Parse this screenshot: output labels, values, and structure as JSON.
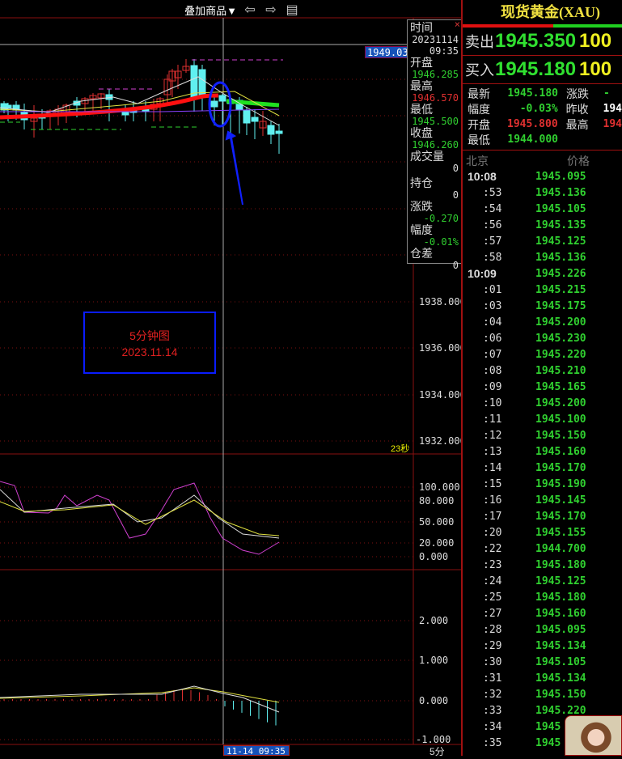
{
  "toolbar": {
    "overlay_label": "叠加商品▼",
    "back_icon": "⇦",
    "forward_icon": "⇨",
    "layout_icon": "▤"
  },
  "chart": {
    "last_price_tag": "1949.03",
    "y_axis": [
      "1938.000",
      "1936.000",
      "1934.000",
      "1932.000"
    ],
    "countdown": "23秒",
    "annotation": {
      "line1": "5分钟图",
      "line2": "2023.11.14"
    },
    "osc_axis": [
      "100.000",
      "80.000",
      "50.000",
      "20.000",
      "0.000"
    ],
    "macd_axis": [
      "2.000",
      "1.000",
      "0.000",
      "-1.000"
    ],
    "cursor_time": "11-14 09:35",
    "period": "5分",
    "colors": {
      "up": "#e03030",
      "down": "#60f0f0",
      "ma_thick": "#ff1010",
      "grid": "#8a1010"
    }
  },
  "tooltip": {
    "time_label": "时间",
    "date": "20231114",
    "time": "09:35",
    "open_label": "开盘",
    "open": "1946.285",
    "high_label": "最高",
    "high": "1946.570",
    "low_label": "最低",
    "low": "1945.500",
    "close_label": "收盘",
    "close": "1946.260",
    "volume_label": "成交量",
    "volume": "0",
    "oi_label": "持仓",
    "oi": "0",
    "change_label": "涨跌",
    "change": "-0.270",
    "pct_label": "幅度",
    "pct": "-0.01%",
    "oi_diff_label": "仓差",
    "oi_diff": "0",
    "close_icon": "×"
  },
  "panel": {
    "title": "现货黄金(XAU)",
    "sell_label": "卖出",
    "sell_price": "1945.350",
    "sell_vol": "100",
    "buy_label": "买入",
    "buy_price": "1945.180",
    "buy_vol": "100",
    "stats": [
      {
        "k1": "最新",
        "v1": "1945.180",
        "c1": "#30d030",
        "k2": "涨跌",
        "v2": "-",
        "c2": "#30d030"
      },
      {
        "k1": "幅度",
        "v1": "-0.03%",
        "c1": "#30d030",
        "k2": "昨收",
        "v2": "194",
        "c2": "#fff"
      },
      {
        "k1": "开盘",
        "v1": "1945.800",
        "c1": "#e03030",
        "k2": "最高",
        "v2": "194",
        "c2": "#e03030"
      },
      {
        "k1": "最低",
        "v1": "1944.000",
        "c1": "#30d030",
        "k2": "",
        "v2": "",
        "c2": "#fff"
      }
    ],
    "tick_header": {
      "time": "北京",
      "price": "价格"
    },
    "ticks": [
      {
        "t": "10:08",
        "p": "1945.095",
        "full": true
      },
      {
        "t": ":53",
        "p": "1945.136"
      },
      {
        "t": ":54",
        "p": "1945.105"
      },
      {
        "t": ":56",
        "p": "1945.135"
      },
      {
        "t": ":57",
        "p": "1945.125"
      },
      {
        "t": ":58",
        "p": "1945.136"
      },
      {
        "t": "10:09",
        "p": "1945.226",
        "full": true
      },
      {
        "t": ":01",
        "p": "1945.215"
      },
      {
        "t": ":03",
        "p": "1945.175"
      },
      {
        "t": ":04",
        "p": "1945.200"
      },
      {
        "t": ":06",
        "p": "1945.230"
      },
      {
        "t": ":07",
        "p": "1945.220"
      },
      {
        "t": ":08",
        "p": "1945.210"
      },
      {
        "t": ":09",
        "p": "1945.165"
      },
      {
        "t": ":10",
        "p": "1945.200"
      },
      {
        "t": ":11",
        "p": "1945.100"
      },
      {
        "t": ":12",
        "p": "1945.150"
      },
      {
        "t": ":13",
        "p": "1945.160"
      },
      {
        "t": ":14",
        "p": "1945.170"
      },
      {
        "t": ":15",
        "p": "1945.190"
      },
      {
        "t": ":16",
        "p": "1945.145"
      },
      {
        "t": ":17",
        "p": "1945.170"
      },
      {
        "t": ":20",
        "p": "1945.155"
      },
      {
        "t": ":22",
        "p": "1944.700"
      },
      {
        "t": ":23",
        "p": "1945.180"
      },
      {
        "t": ":24",
        "p": "1945.125"
      },
      {
        "t": ":25",
        "p": "1945.180"
      },
      {
        "t": ":27",
        "p": "1945.160"
      },
      {
        "t": ":28",
        "p": "1945.095"
      },
      {
        "t": ":29",
        "p": "1945.134"
      },
      {
        "t": ":30",
        "p": "1945.105"
      },
      {
        "t": ":31",
        "p": "1945.134"
      },
      {
        "t": ":32",
        "p": "1945.150"
      },
      {
        "t": ":33",
        "p": "1945.220"
      },
      {
        "t": ":34",
        "p": "1945"
      },
      {
        "t": ":35",
        "p": "1945"
      }
    ]
  }
}
